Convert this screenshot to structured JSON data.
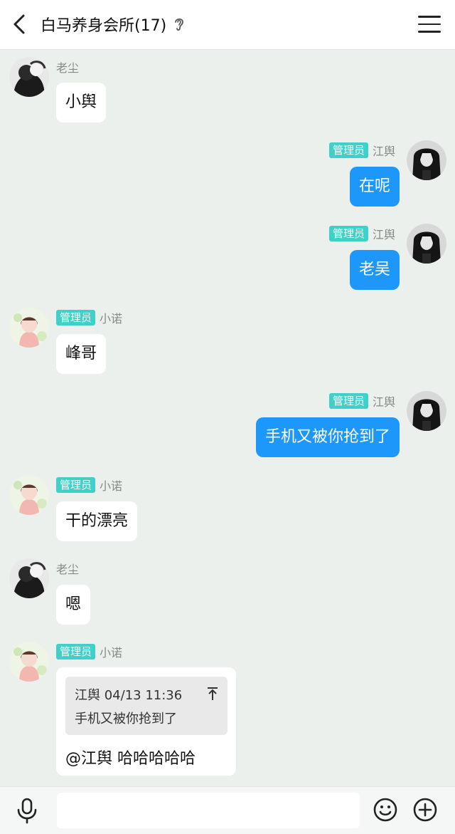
{
  "header": {
    "title": "白马养身会所(17)",
    "back_icon": "chevron-left-icon",
    "ear_icon": "ear-icon",
    "menu_icon": "hamburger-menu-icon"
  },
  "colors": {
    "background": "#ebf0ec",
    "outgoing_bubble": "#1e97fb",
    "admin_badge": "#3ed1c7"
  },
  "messages": [
    {
      "sender": "老尘",
      "badge": "",
      "text": "小舆",
      "side": "left"
    },
    {
      "sender": "江舆",
      "badge": "管理员",
      "text": "在呢",
      "side": "right"
    },
    {
      "sender": "江舆",
      "badge": "管理员",
      "text": "老吴",
      "side": "right"
    },
    {
      "sender": "小诺",
      "badge": "管理员",
      "text": "峰哥",
      "side": "left"
    },
    {
      "sender": "江舆",
      "badge": "管理员",
      "text": "手机又被你抢到了",
      "side": "right"
    },
    {
      "sender": "小诺",
      "badge": "管理员",
      "text": "干的漂亮",
      "side": "left"
    },
    {
      "sender": "老尘",
      "badge": "",
      "text": "嗯",
      "side": "left"
    },
    {
      "sender": "小诺",
      "badge": "管理员",
      "side": "left",
      "quote": {
        "head": "江舆 04/13 11:36",
        "text": "手机又被你抢到了",
        "icon": "pin-top-icon"
      },
      "text": "@江舆 哈哈哈哈哈"
    }
  ],
  "bottom_bar": {
    "mic_icon": "microphone-icon",
    "input_value": "",
    "emoji_icon": "smiley-icon",
    "plus_icon": "plus-circle-icon"
  }
}
